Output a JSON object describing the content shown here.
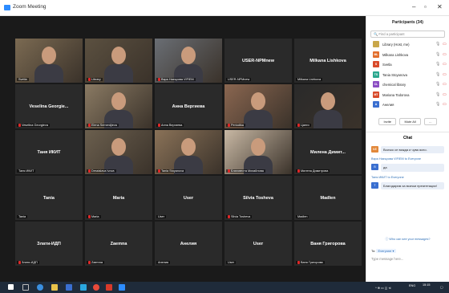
{
  "window": {
    "title": "Zoom Meeting"
  },
  "panel": {
    "title": "Participants (34)",
    "search_placeholder": "Find a participant",
    "participants": [
      {
        "initials": "",
        "name": "Library (Host, me)",
        "color": "#c9a74a"
      },
      {
        "initials": "ML",
        "name": "Milkana Lishkova",
        "color": "#e26e2c"
      },
      {
        "initials": "S",
        "name": "Svetla",
        "color": "#d84a2a"
      },
      {
        "initials": "TS",
        "name": "Tania Stoyanova",
        "color": "#2aa78e"
      },
      {
        "initials": "CL",
        "name": "chemical library",
        "color": "#8a4cc2"
      },
      {
        "initials": "MT",
        "name": "Mariana Todorova",
        "color": "#d84a2a"
      },
      {
        "initials": "A",
        "name": "Анелия",
        "color": "#3a6fd0"
      }
    ],
    "invite_label": "Invite",
    "mute_all_label": "Mute All",
    "more_label": "..."
  },
  "chat": {
    "title": "Chat",
    "messages": [
      {
        "avatar": "ME",
        "color": "#e2883a",
        "sender": "",
        "text": "Всичко се вижда и чува ясно."
      },
      {
        "avatar": "В",
        "color": "#3a6fd0",
        "sender": "Вяра Назърова VIFIEM to Everyone",
        "text": "да"
      },
      {
        "avatar": "T",
        "color": "#3a6fd0",
        "sender": "Таня ИКИТ to Everyone",
        "text": "Благодарим за всички презентации!"
      }
    ],
    "who_can_see": "Who can see your messages?",
    "to_label": "To:",
    "to_value": "Everyone",
    "input_placeholder": "Type message here..."
  },
  "tiles": [
    {
      "label": "Svetla",
      "center": "",
      "video": true,
      "muted": false
    },
    {
      "label": "Library",
      "center": "",
      "video": true,
      "muted": true
    },
    {
      "label": "Вяра Назърова VIFIEM",
      "center": "",
      "video": true,
      "muted": true
    },
    {
      "label": "USER-NPMnew",
      "center": "USER-NPMnew",
      "video": false,
      "muted": false
    },
    {
      "label": "Milkana Lishkova",
      "center": "Milkana Lishkova",
      "video": false,
      "muted": false
    },
    {
      "label": "Veselina Georgieva",
      "center": "Veselina Georgie...",
      "video": false,
      "muted": true
    },
    {
      "label": "Elena Semerdjieva",
      "center": "",
      "video": true,
      "muted": true
    },
    {
      "label": "Анна Вергиева",
      "center": "Анна Вергиева",
      "video": false,
      "muted": true
    },
    {
      "label": "Periodika",
      "center": "",
      "video": true,
      "muted": true
    },
    {
      "label": "Цанги",
      "center": "",
      "video": true,
      "muted": true
    },
    {
      "label": "Таня ИКИТ",
      "center": "Таня ИКИТ",
      "video": false,
      "muted": false
    },
    {
      "label": "Dessislava Ivova",
      "center": "",
      "video": true,
      "muted": true
    },
    {
      "label": "Tania Stoyanova",
      "center": "",
      "video": true,
      "muted": true
    },
    {
      "label": "Благовеста Михайлова",
      "center": "",
      "video": true,
      "muted": true
    },
    {
      "label": "Милена Димитрова",
      "center": "Милена Димит...",
      "video": false,
      "muted": true
    },
    {
      "label": "Tania",
      "center": "Tania",
      "video": false,
      "muted": false
    },
    {
      "label": "Maria",
      "center": "Maria",
      "video": false,
      "muted": true
    },
    {
      "label": "User",
      "center": "User",
      "video": false,
      "muted": false
    },
    {
      "label": "Silvia Tosheva",
      "center": "Silvia Tosheva",
      "video": false,
      "muted": true
    },
    {
      "label": "Madlen",
      "center": "Madlen",
      "video": false,
      "muted": false
    },
    {
      "label": "Злати-ИДП",
      "center": "Злати-ИДП",
      "video": false,
      "muted": true
    },
    {
      "label": "Zaemna",
      "center": "Zaemna",
      "video": false,
      "muted": true
    },
    {
      "label": "Анелия",
      "center": "Анелия",
      "video": false,
      "muted": false
    },
    {
      "label": "User",
      "center": "User",
      "video": false,
      "muted": false
    },
    {
      "label": "Ваня Григорова",
      "center": "Ваня Григорова",
      "video": false,
      "muted": true
    }
  ],
  "taskbar": {
    "lang": "ENG",
    "time": "15:15"
  }
}
